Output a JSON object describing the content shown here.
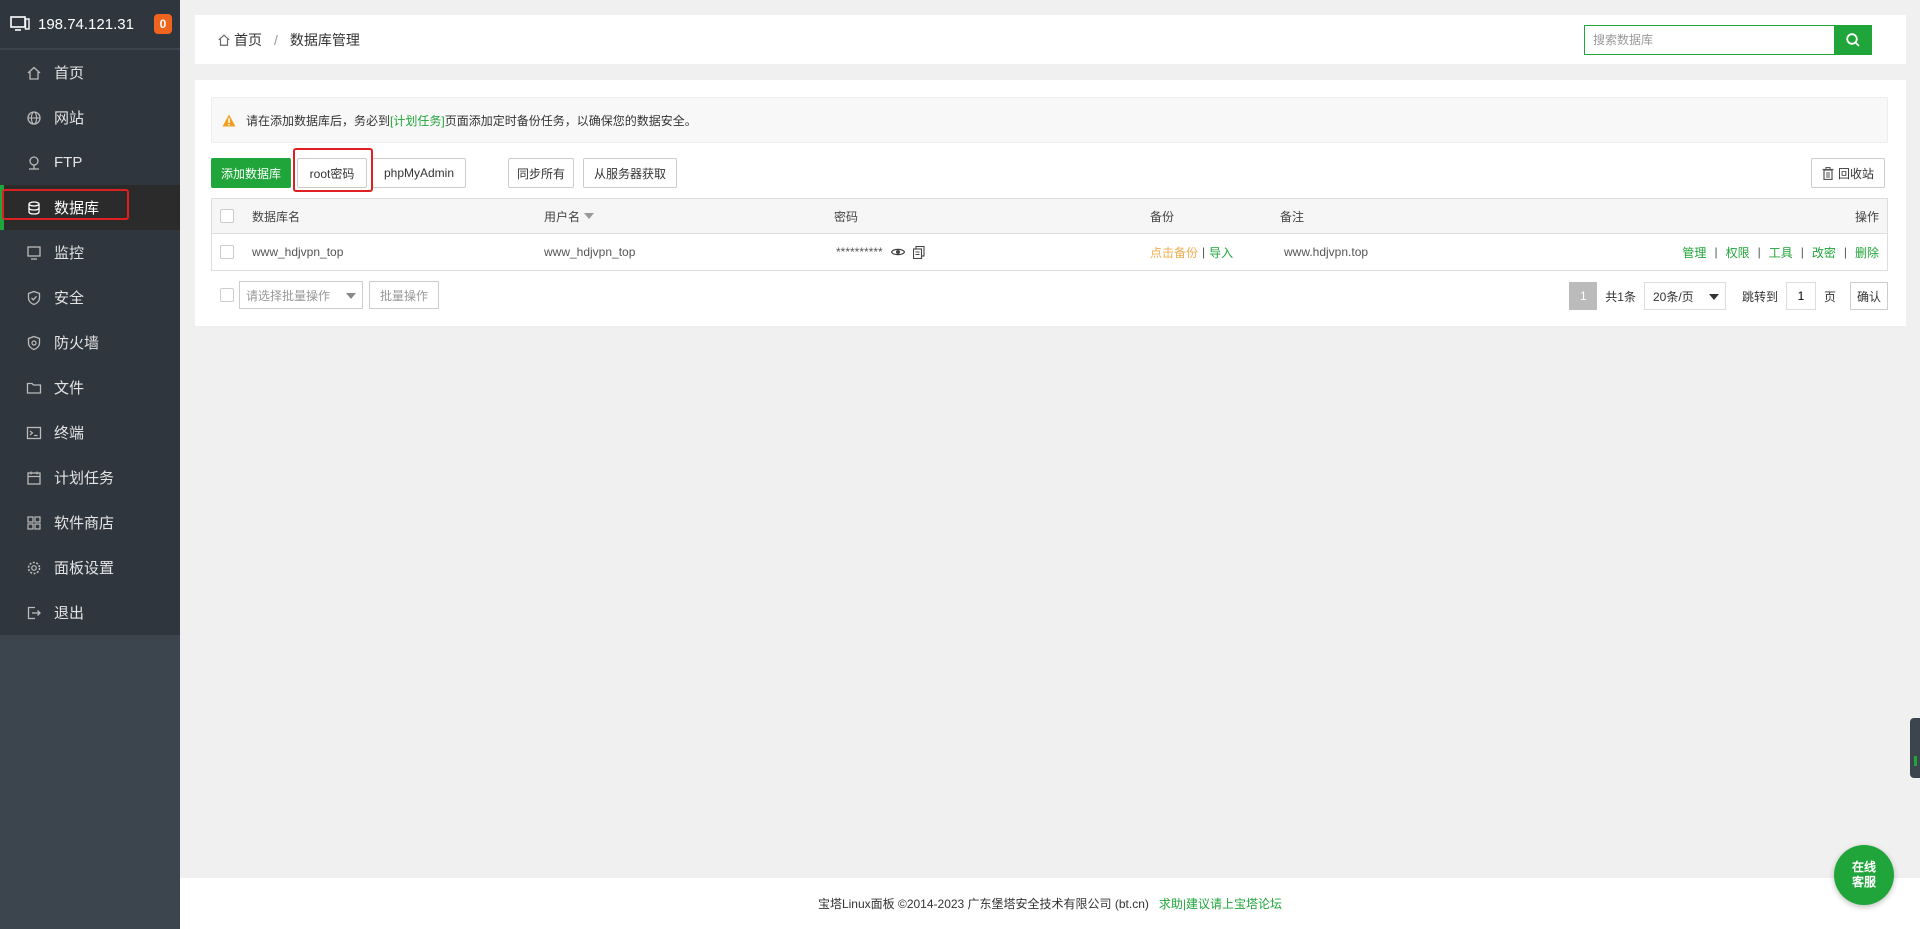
{
  "sidebar": {
    "server_ip": "198.74.121.31",
    "badge_count": "0",
    "items": [
      {
        "label": "首页",
        "icon": "home-icon"
      },
      {
        "label": "网站",
        "icon": "globe-icon"
      },
      {
        "label": "FTP",
        "icon": "ftp-icon"
      },
      {
        "label": "数据库",
        "icon": "database-icon",
        "active": true
      },
      {
        "label": "监控",
        "icon": "monitor-icon"
      },
      {
        "label": "安全",
        "icon": "shield-icon"
      },
      {
        "label": "防火墙",
        "icon": "firewall-icon"
      },
      {
        "label": "文件",
        "icon": "folder-icon"
      },
      {
        "label": "终端",
        "icon": "terminal-icon"
      },
      {
        "label": "计划任务",
        "icon": "calendar-icon"
      },
      {
        "label": "软件商店",
        "icon": "grid-icon"
      },
      {
        "label": "面板设置",
        "icon": "gear-icon"
      },
      {
        "label": "退出",
        "icon": "logout-icon"
      }
    ]
  },
  "header": {
    "breadcrumb": {
      "home": "首页",
      "separator": "/",
      "current": "数据库管理"
    },
    "search": {
      "placeholder": "搜索数据库"
    }
  },
  "notice": {
    "text_before": "请在添加数据库后，务必到",
    "link": "[计划任务]",
    "text_after": "页面添加定时备份任务，以确保您的数据安全。"
  },
  "toolbar": {
    "add_db": "添加数据库",
    "root_password": "root密码",
    "phpmyadmin": "phpMyAdmin",
    "sync_all": "同步所有",
    "fetch_from_server": "从服务器获取",
    "recycle_bin": "回收站"
  },
  "table": {
    "headers": {
      "name": "数据库名",
      "username": "用户名",
      "password": "密码",
      "backup": "备份",
      "note": "备注",
      "actions": "操作"
    },
    "rows": [
      {
        "name": "www_hdjvpn_top",
        "username": "www_hdjvpn_top",
        "password": "**********",
        "backup_link": "点击备份",
        "backup_sep": "|",
        "import_link": "导入",
        "note": "www.hdjvpn.top",
        "actions": [
          "管理",
          "权限",
          "工具",
          "改密",
          "删除"
        ],
        "action_sep": "|"
      }
    ]
  },
  "bottom": {
    "batch_select_placeholder": "请选择批量操作",
    "batch_button": "批量操作",
    "pager": {
      "current_page": "1",
      "total": "共1条",
      "page_size": "20条/页",
      "jump_label": "跳转到",
      "jump_value": "1",
      "page_unit": "页",
      "confirm": "确认"
    }
  },
  "footer": {
    "copyright": "宝塔Linux面板 ©2014-2023 广东堡塔安全技术有限公司 (bt.cn)",
    "link": "求助|建议请上宝塔论坛"
  },
  "chat": {
    "label": "在线\n客服"
  },
  "colors": {
    "accent": "#20a53a",
    "sidebar_bg": "#3c444d",
    "highlight": "#e02020",
    "warning": "#f0ad4e"
  }
}
